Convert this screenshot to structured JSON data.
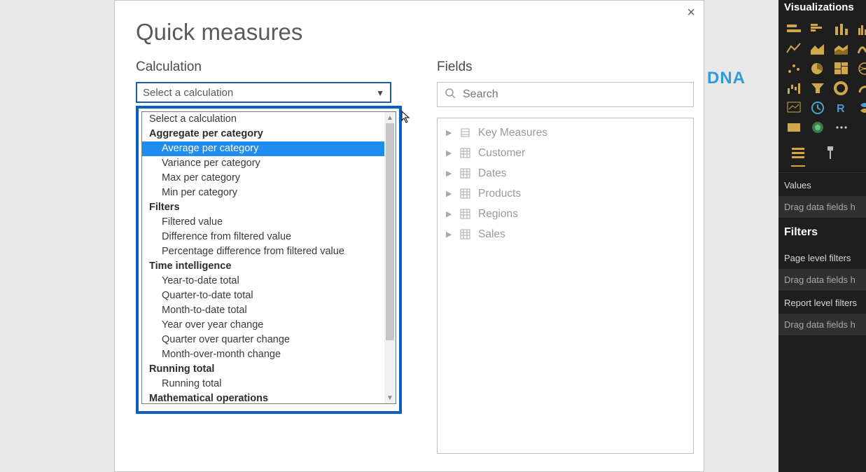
{
  "brand_fragment": "E DNA",
  "dialog": {
    "title": "Quick measures",
    "close_glyph": "×",
    "calculation": {
      "label": "Calculation",
      "selected": "Select a calculation",
      "placeholder_option": "Select a calculation",
      "groups": [
        {
          "name": "Aggregate per category",
          "items": [
            "Average per category",
            "Variance per category",
            "Max per category",
            "Min per category"
          ]
        },
        {
          "name": "Filters",
          "items": [
            "Filtered value",
            "Difference from filtered value",
            "Percentage difference from filtered value"
          ]
        },
        {
          "name": "Time intelligence",
          "items": [
            "Year-to-date total",
            "Quarter-to-date total",
            "Month-to-date total",
            "Year over year change",
            "Quarter over quarter change",
            "Month-over-month change"
          ]
        },
        {
          "name": "Running total",
          "items": [
            "Running total"
          ]
        },
        {
          "name": "Mathematical operations",
          "items": []
        }
      ],
      "highlighted_item": "Average per category"
    },
    "fields": {
      "label": "Fields",
      "search_placeholder": "Search",
      "tables": [
        {
          "name": "Key Measures",
          "icon": "measure"
        },
        {
          "name": "Customer",
          "icon": "table"
        },
        {
          "name": "Dates",
          "icon": "table"
        },
        {
          "name": "Products",
          "icon": "table"
        },
        {
          "name": "Regions",
          "icon": "table"
        },
        {
          "name": "Sales",
          "icon": "table"
        }
      ]
    }
  },
  "viz_pane": {
    "title": "Visualizations",
    "icons": [
      "stacked-bar-icon",
      "clustered-bar-icon",
      "stacked-column-icon",
      "clustered-column-icon",
      "line-chart-icon",
      "area-chart-icon",
      "stacked-area-icon",
      "ribbon-chart-icon",
      "scatter-chart-icon",
      "pie-chart-icon",
      "treemap-icon",
      "map-icon",
      "waterfall-icon",
      "funnel-icon",
      "donut-icon",
      "gauge-icon",
      "kpi-icon",
      "card-icon",
      "r-visual-icon",
      "python-visual-icon",
      "table-icon",
      "arcgis-icon",
      "more-icon",
      "blank-icon"
    ],
    "tools": {
      "fields": "fields-tool-icon",
      "format": "format-tool-icon"
    },
    "values_label": "Values",
    "values_placeholder": "Drag data fields h",
    "filters_header": "Filters",
    "page_level_label": "Page level filters",
    "page_level_placeholder": "Drag data fields h",
    "report_level_label": "Report level filters",
    "report_level_placeholder": "Drag data fields h"
  }
}
